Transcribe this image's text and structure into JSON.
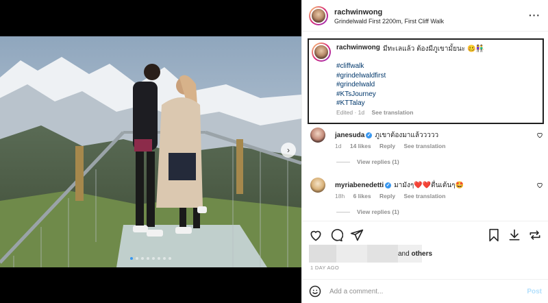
{
  "post": {
    "username": "rachwinwong",
    "location": "Grindelwald First 2200m, First Cliff Walk",
    "more_label": "···"
  },
  "caption": {
    "username": "rachwinwong",
    "text": "มีทะเลแล้ว ต้องมีภูเขามั้ยนะ 🥴👫",
    "hashtags": [
      "#cliffwalk",
      "#grindelwaldfirst",
      "#grindelwald",
      "#KTsJourney",
      "#KTTalay"
    ],
    "edited": "Edited · 1d",
    "see_translation": "See translation"
  },
  "comments": [
    {
      "username": "janesuda",
      "text": "ภูเขาต้องมาแล้ววววว",
      "time": "1d",
      "likes": "14 likes",
      "reply": "Reply",
      "see_translation": "See translation",
      "view_replies": "View replies (1)"
    },
    {
      "username": "myriabenedetti",
      "text": "มามังๆ❤️❤️ตื่นเต้นๆ🤩",
      "time": "18h",
      "likes": "6 likes",
      "reply": "Reply",
      "see_translation": "See translation",
      "view_replies": "View replies (1)"
    }
  ],
  "likes": {
    "others_prefix": "and",
    "others_label": "others"
  },
  "date": "1 DAY AGO",
  "add_comment": {
    "placeholder": "Add a comment...",
    "post_label": "Post"
  },
  "colors": {
    "link": "#00376b",
    "verified": "#3897f0",
    "muted": "#8e8e8e"
  },
  "carousel": {
    "slides": 8,
    "active": 1
  },
  "icons": [
    "heart-icon",
    "comment-icon",
    "share-icon",
    "bookmark-icon",
    "download-icon",
    "repost-icon",
    "smile-icon",
    "chevron-right-icon"
  ]
}
